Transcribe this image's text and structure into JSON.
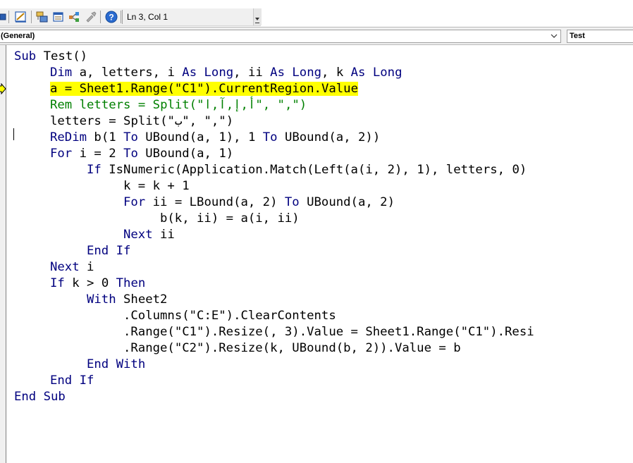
{
  "toolbar": {
    "status": "Ln 3, Col 1",
    "icons": [
      "object-icon",
      "design-mode-icon",
      "project-explorer-icon",
      "properties-icon",
      "toolbox-icon",
      "help-icon"
    ]
  },
  "combos": {
    "object": "(General)",
    "procedure": "Test"
  },
  "colors": {
    "keyword": "#00007f",
    "comment": "#008000",
    "highlight": "#ffff00"
  },
  "code": {
    "line1": {
      "kw1": "Sub",
      "t1": " Test()"
    },
    "line2": {
      "kw1": "Dim",
      "t1": " a, letters, i ",
      "kw2": "As",
      "t2": " ",
      "kw3": "Long",
      "t3": ", ii ",
      "kw4": "As",
      "t4": " ",
      "kw5": "Long",
      "t5": ", k ",
      "kw6": "As",
      "t6": " ",
      "kw7": "Long"
    },
    "line3": {
      "text": "a = Sheet1.Range(\"C1\").CurrentRegion.Value"
    },
    "line4": {
      "text": "Rem letters = Split(\"أ,إ,آ,ا\", \",\")"
    },
    "line5": {
      "t1": "letters = Split(\"ب\", \",\")"
    },
    "line6": {
      "kw1": "ReDim",
      "t1": " b(1 ",
      "kw2": "To",
      "t2": " UBound(a, 1), 1 ",
      "kw3": "To",
      "t3": " UBound(a, 2))"
    },
    "line7": {
      "kw1": "For",
      "t1": " i = 2 ",
      "kw2": "To",
      "t2": " UBound(a, 1)"
    },
    "line8": {
      "kw1": "If",
      "t1": " IsNumeric(Application.Match(Left(a(i, 2), 1), letters, 0)"
    },
    "line9": {
      "t1": "k = k + 1"
    },
    "line10": {
      "kw1": "For",
      "t1": " ii = LBound(a, 2) ",
      "kw2": "To",
      "t2": " UBound(a, 2)"
    },
    "line11": {
      "t1": "b(k, ii) = a(i, ii)"
    },
    "line12": {
      "kw1": "Next",
      "t1": " ii"
    },
    "line13": {
      "kw1": "End If"
    },
    "line14": {
      "kw1": "Next",
      "t1": " i"
    },
    "line15": {
      "kw1": "If",
      "t1": " k > 0 ",
      "kw2": "Then"
    },
    "line16": {
      "kw1": "With",
      "t1": " Sheet2"
    },
    "line17": {
      "t1": ".Columns(\"C:E\").ClearContents"
    },
    "line18": {
      "t1": ".Range(\"C1\").Resize(, 3).Value = Sheet1.Range(\"C1\").Resi"
    },
    "line19": {
      "t1": ".Range(\"C2\").Resize(k, UBound(b, 2)).Value = b"
    },
    "line20": {
      "kw1": "End With"
    },
    "line21": {
      "kw1": "End If"
    },
    "line22": {
      "kw1": "End Sub"
    }
  }
}
